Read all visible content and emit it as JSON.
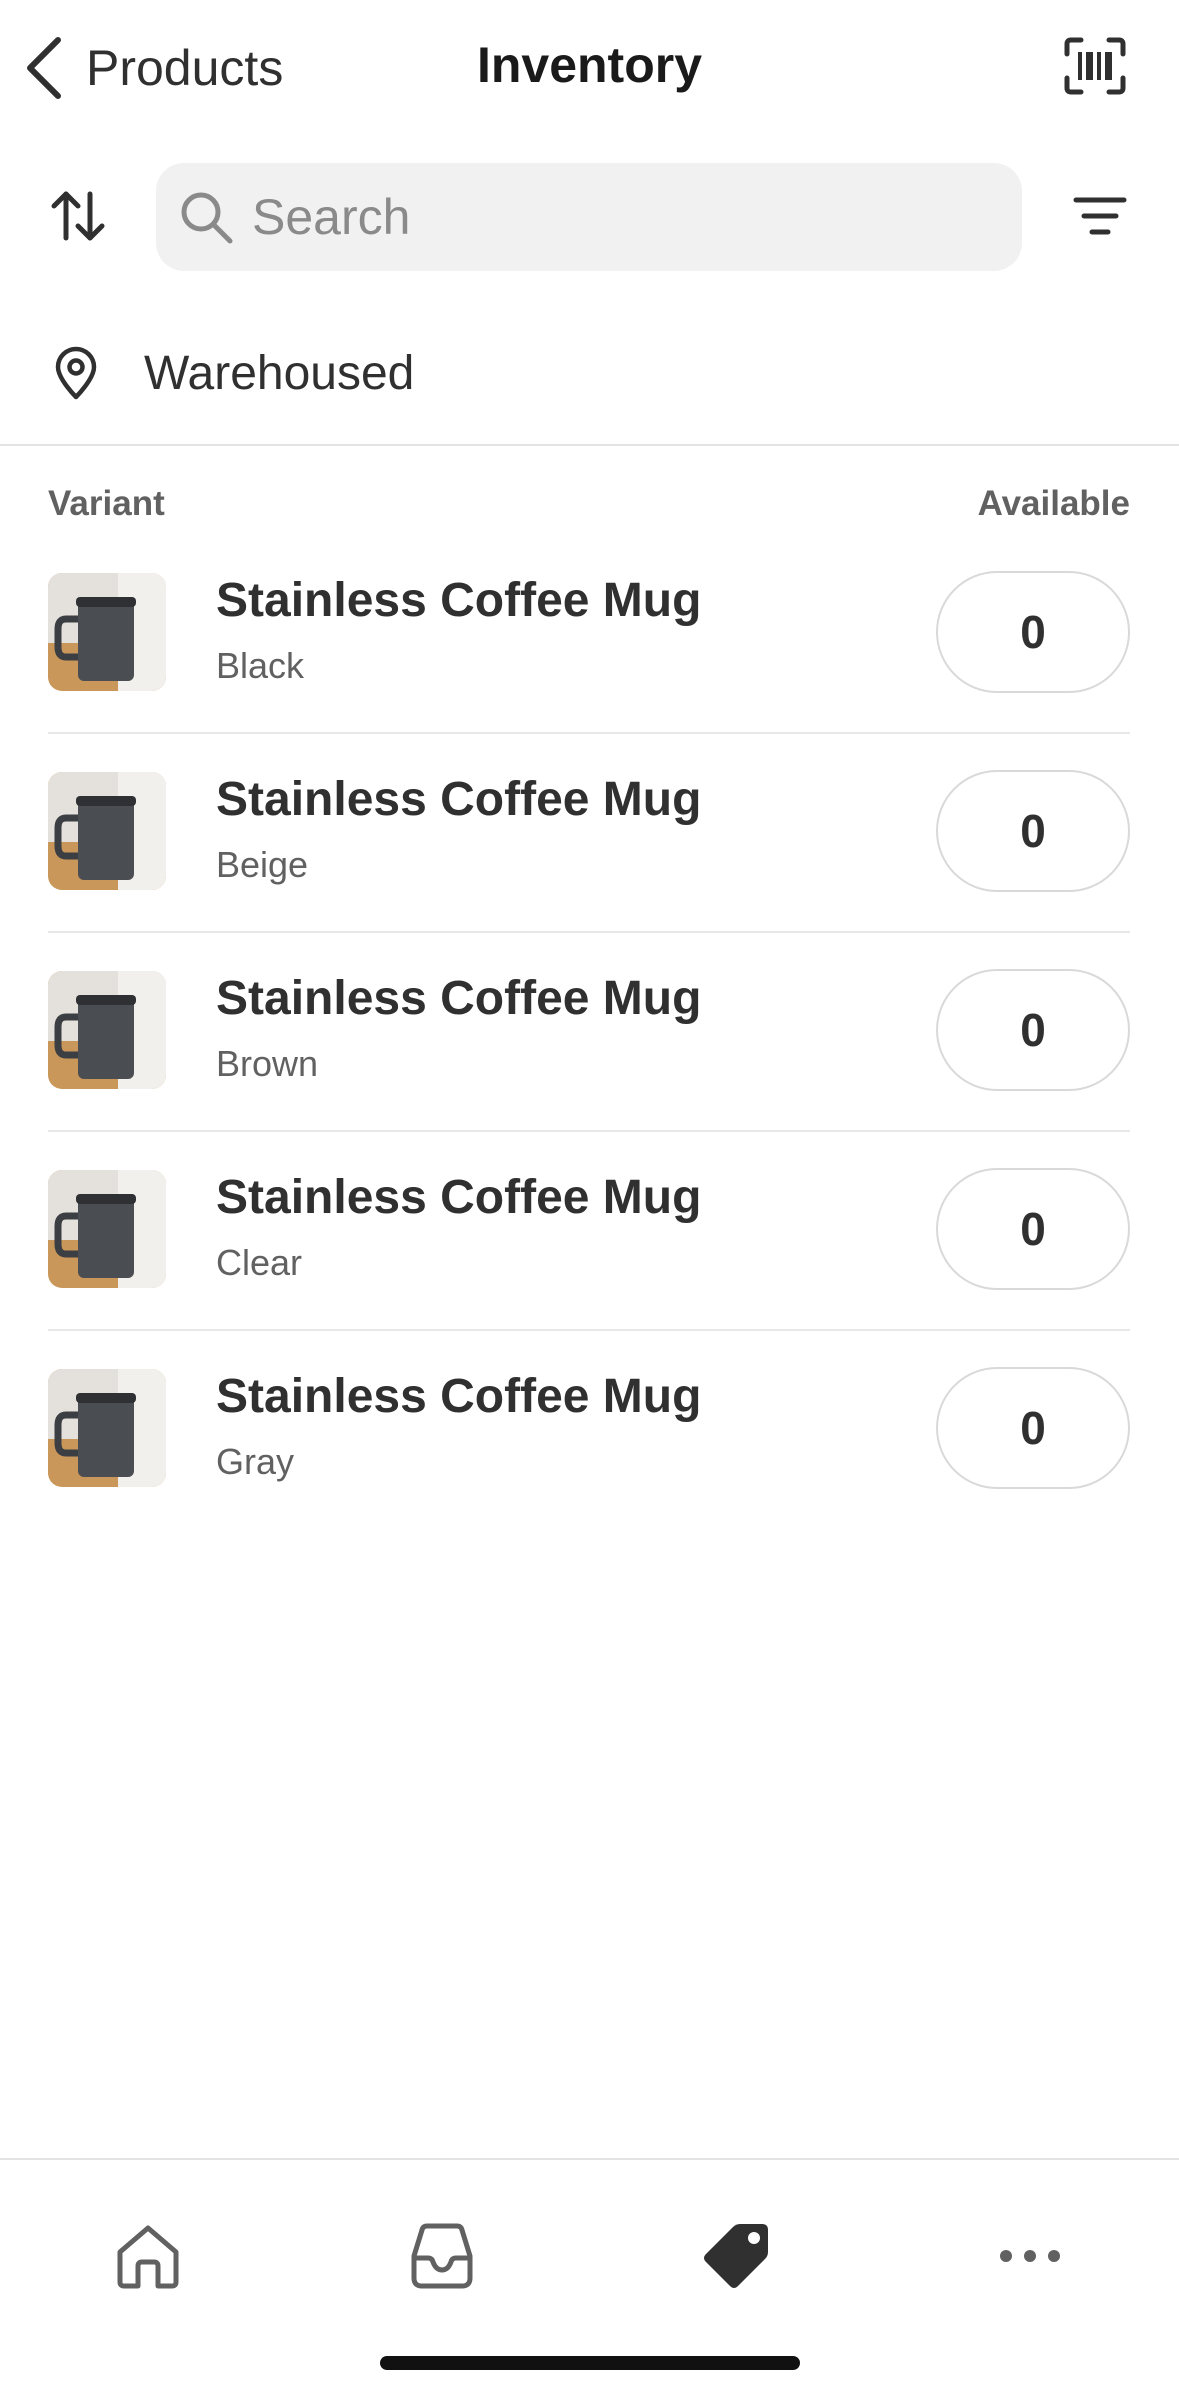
{
  "header": {
    "back_label": "Products",
    "title": "Inventory",
    "back_icon": "chevron-left-icon",
    "scan_icon": "barcode-scan-icon"
  },
  "search": {
    "placeholder": "Search",
    "value": "",
    "sort_icon": "sort-arrows-icon",
    "filter_icon": "filter-icon"
  },
  "location": {
    "label": "Warehoused",
    "icon": "location-pin-icon"
  },
  "table": {
    "columns": [
      "Variant",
      "Available"
    ],
    "rows": [
      {
        "title": "Stainless Coffee Mug",
        "variant": "Black",
        "available": "0"
      },
      {
        "title": "Stainless Coffee Mug",
        "variant": "Beige",
        "available": "0"
      },
      {
        "title": "Stainless Coffee Mug",
        "variant": "Brown",
        "available": "0"
      },
      {
        "title": "Stainless Coffee Mug",
        "variant": "Clear",
        "available": "0"
      },
      {
        "title": "Stainless Coffee Mug",
        "variant": "Gray",
        "available": "0"
      }
    ]
  },
  "tabbar": {
    "items": [
      {
        "icon": "home-icon",
        "active": false
      },
      {
        "icon": "inbox-icon",
        "active": false
      },
      {
        "icon": "tag-icon",
        "active": true
      },
      {
        "icon": "more-icon",
        "active": false
      }
    ]
  },
  "colors": {
    "text": "#303030",
    "muted": "#616161",
    "search_bg": "#f1f1f1",
    "border": "#e3e3e3"
  }
}
